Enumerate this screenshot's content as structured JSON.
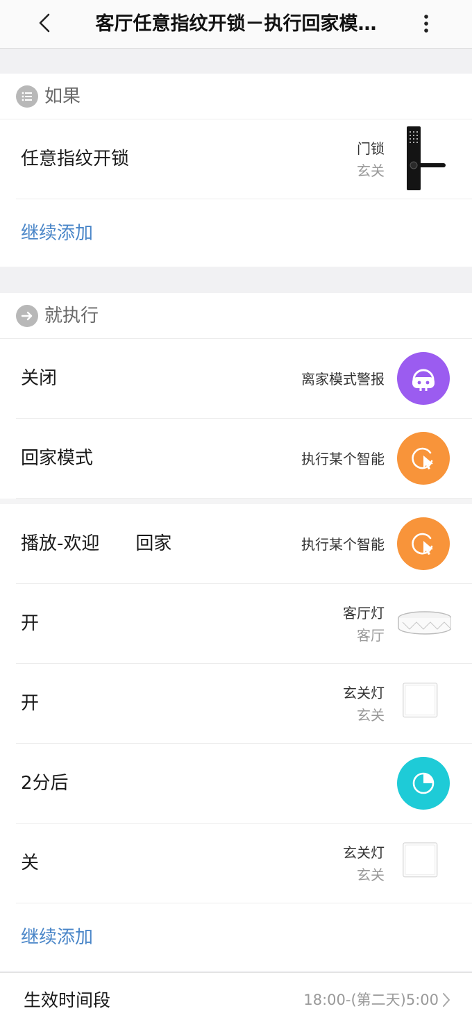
{
  "header": {
    "title": "客厅任意指纹开锁－执行回家模…",
    "back_icon": "chevron-left-icon",
    "more_icon": "more-vertical-icon"
  },
  "if_section": {
    "heading": "如果",
    "heading_icon": "list-icon",
    "rows": [
      {
        "label": "任意指纹开锁",
        "device": "门锁",
        "room": "玄关",
        "icon": "door-lock-icon"
      }
    ],
    "add_label": "继续添加"
  },
  "then_section": {
    "heading": "就执行",
    "heading_icon": "arrow-right-icon",
    "rows": [
      {
        "label": "关闭",
        "device": "离家模式警报",
        "room": "",
        "icon": "robot-icon",
        "color": "#9b5cf0"
      },
      {
        "label": "回家模式",
        "device": "执行某个智能",
        "room": "",
        "icon": "smart-execute-icon",
        "color": "#f8943a"
      },
      {
        "label": "播放-欢迎　　回家",
        "device": "执行某个智能",
        "room": "",
        "icon": "smart-execute-icon",
        "color": "#f8943a"
      },
      {
        "label": "开",
        "device": "客厅灯",
        "room": "客厅",
        "icon": "ceiling-light-icon"
      },
      {
        "label": "开",
        "device": "玄关灯",
        "room": "玄关",
        "icon": "wall-switch-icon"
      },
      {
        "label": "2分后",
        "device": "",
        "room": "",
        "icon": "timer-icon",
        "color": "#1ecbd7"
      },
      {
        "label": "关",
        "device": "玄关灯",
        "room": "玄关",
        "icon": "wall-switch-icon"
      }
    ],
    "add_label": "继续添加"
  },
  "schedule": {
    "label": "生效时间段",
    "value": "18:00-(第二天)5:00",
    "chevron_icon": "chevron-right-icon"
  },
  "colors": {
    "link": "#4a86c8",
    "robot": "#9b5cf0",
    "orange": "#f8943a",
    "teal": "#1ecbd7"
  }
}
